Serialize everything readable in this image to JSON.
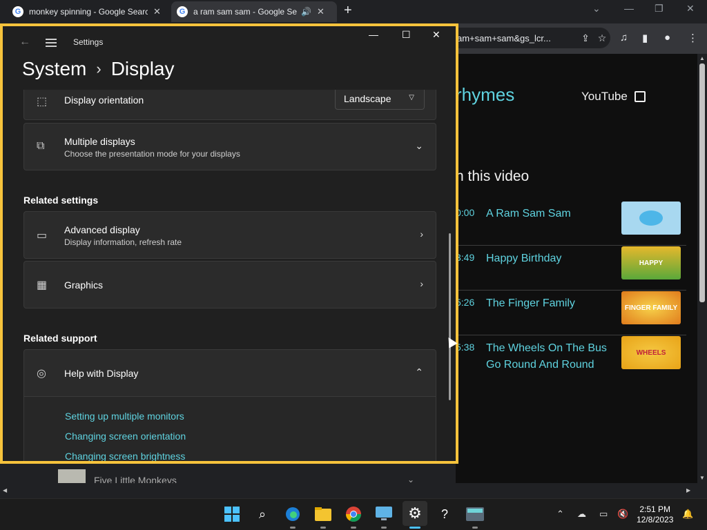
{
  "chrome": {
    "tabs": [
      {
        "title": "monkey spinning - Google Searc",
        "favicon": "G"
      },
      {
        "title": "a ram sam sam - Google Se",
        "favicon": "G",
        "audio": "🔊"
      }
    ],
    "new_tab": "+",
    "window_controls": {
      "minimize": "—",
      "maximize": "❐",
      "close": "✕",
      "tab_search": "⌄"
    },
    "address": "am+sam+sam&gs_lcr..."
  },
  "youtube": {
    "channel_title": "rhymes",
    "youtube_link": "YouTube",
    "in_this_video": "n this video",
    "chapters": [
      {
        "time": "0:00",
        "title": "A Ram Sam Sam",
        "thumb_label": ""
      },
      {
        "time": "3:49",
        "title": "Happy Birthday",
        "thumb_label": "HAPPY"
      },
      {
        "time": "5:26",
        "title": "The Finger Family",
        "thumb_label": "FINGER FAMILY"
      },
      {
        "time": "5:38",
        "title": "The Wheels On The Bus Go Round And Round",
        "thumb_label": "WHEELS"
      }
    ],
    "below_title": "Five Little Monkeys"
  },
  "settings": {
    "app_title": "Settings",
    "breadcrumb_parent": "System",
    "breadcrumb_sep": "›",
    "breadcrumb_current": "Display",
    "controls": {
      "minimize": "—",
      "maximize": "☐",
      "close": "✕"
    },
    "orientation": {
      "label": "Display orientation",
      "value": "Landscape"
    },
    "multiple_displays": {
      "title": "Multiple displays",
      "subtitle": "Choose the presentation mode for your displays"
    },
    "related_settings_heading": "Related settings",
    "advanced_display": {
      "title": "Advanced display",
      "subtitle": "Display information, refresh rate"
    },
    "graphics": {
      "title": "Graphics"
    },
    "related_support_heading": "Related support",
    "help": {
      "title": "Help with Display"
    },
    "help_links": [
      "Setting up multiple monitors",
      "Changing screen orientation",
      "Changing screen brightness"
    ]
  },
  "taskbar": {
    "time": "2:51 PM",
    "date": "12/8/2023"
  },
  "colors": {
    "accent": "#5fd3e0",
    "settings_border": "#f6c33c"
  }
}
